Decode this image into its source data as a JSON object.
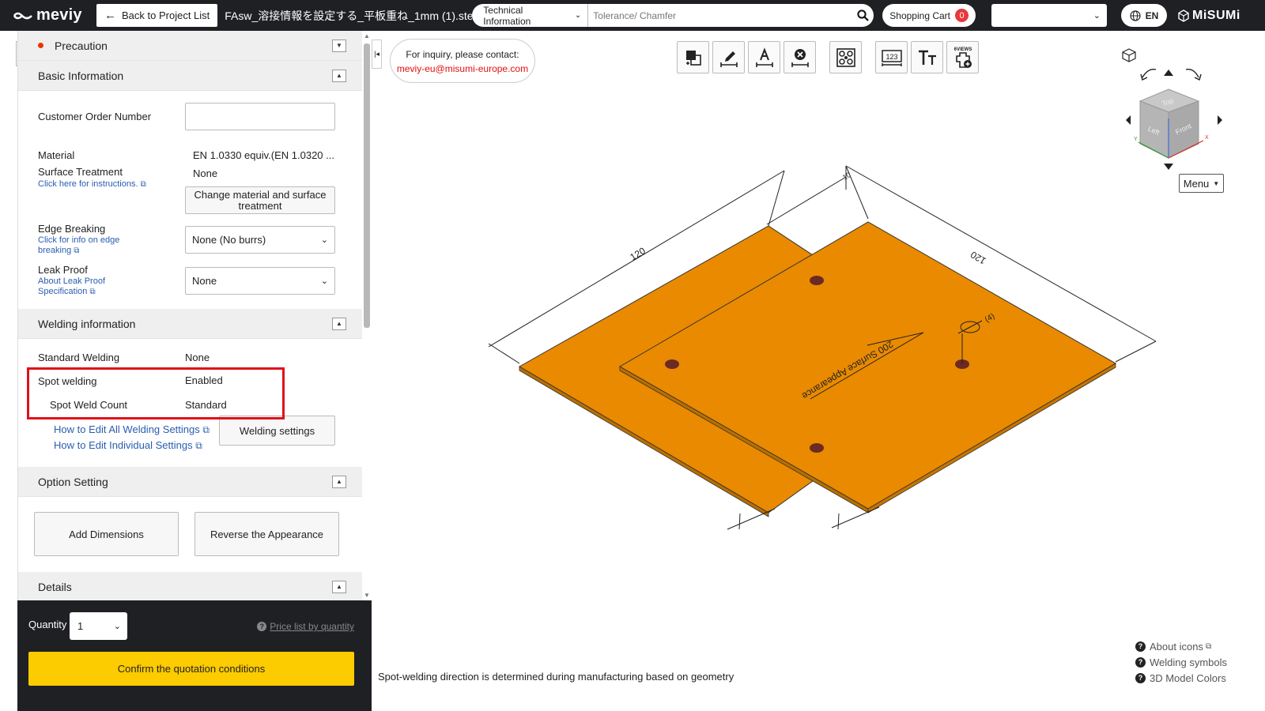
{
  "topbar": {
    "logo": "meviy",
    "back_label": "Back to Project List",
    "file_name": "FAsw_溶接情報を設定する_平板重ね_1mm (1).step",
    "search_category": "Technical Information",
    "search_placeholder": "Tolerance/ Chamfer",
    "cart_label": "Shopping Cart",
    "cart_count": "0",
    "language": "EN",
    "brand": "MiSUMi"
  },
  "panel": {
    "precaution": "Precaution",
    "basic_info": {
      "title": "Basic Information",
      "customer_order_label": "Customer Order Number",
      "customer_order_value": "",
      "material_label": "Material",
      "material_value": "EN 1.0330 equiv.(EN 1.0320 ...",
      "surface_label": "Surface Treatment",
      "surface_value": "None",
      "surface_link": "Click here for instructions.",
      "change_button": "Change material and surface treatment",
      "edge_label": "Edge Breaking",
      "edge_link_1": "Click for info on edge",
      "edge_link_2": "breaking",
      "edge_value": "None (No burrs)",
      "leak_label": "Leak Proof",
      "leak_link_1": "About Leak Proof",
      "leak_link_2": "Specification",
      "leak_value": "None"
    },
    "welding": {
      "title": "Welding information",
      "standard_label": "Standard Welding",
      "standard_value": "None",
      "spot_label": "Spot welding",
      "spot_value": "Enabled",
      "count_label": "Spot Weld Count",
      "count_value": "Standard",
      "link_all": "How to Edit All Welding Settings",
      "link_individual": "How to Edit Individual Settings",
      "settings_button": "Welding settings"
    },
    "option": {
      "title": "Option Setting",
      "add_dimensions": "Add Dimensions",
      "reverse": "Reverse the Appearance"
    },
    "details": {
      "title": "Details"
    }
  },
  "quantity": {
    "label": "Quantity",
    "value": "1",
    "price_link": "Price list by quantity",
    "confirm": "Confirm the quotation conditions"
  },
  "viewer": {
    "inquiry_line1": "For inquiry, please contact:",
    "inquiry_email": "meviy-eu@misumi-europe.com",
    "toolbar_6views": "6VIEWS",
    "menu": "Menu",
    "cube_faces": {
      "top": "Top",
      "left": "Left",
      "front": "Front"
    },
    "dim_left": "120",
    "dim_right": "120",
    "dim_small": "10",
    "weld_annotation": "200 Surface Appearance",
    "weld_count_mark": "(4)",
    "spot_note": "Spot-welding direction is determined during manufacturing based on geometry",
    "help": [
      "About icons",
      "Welding symbols",
      "3D Model Colors"
    ],
    "colors": {
      "plate": "#e98a00",
      "spot": "#6b2a22",
      "accent": "#fccb00"
    }
  }
}
